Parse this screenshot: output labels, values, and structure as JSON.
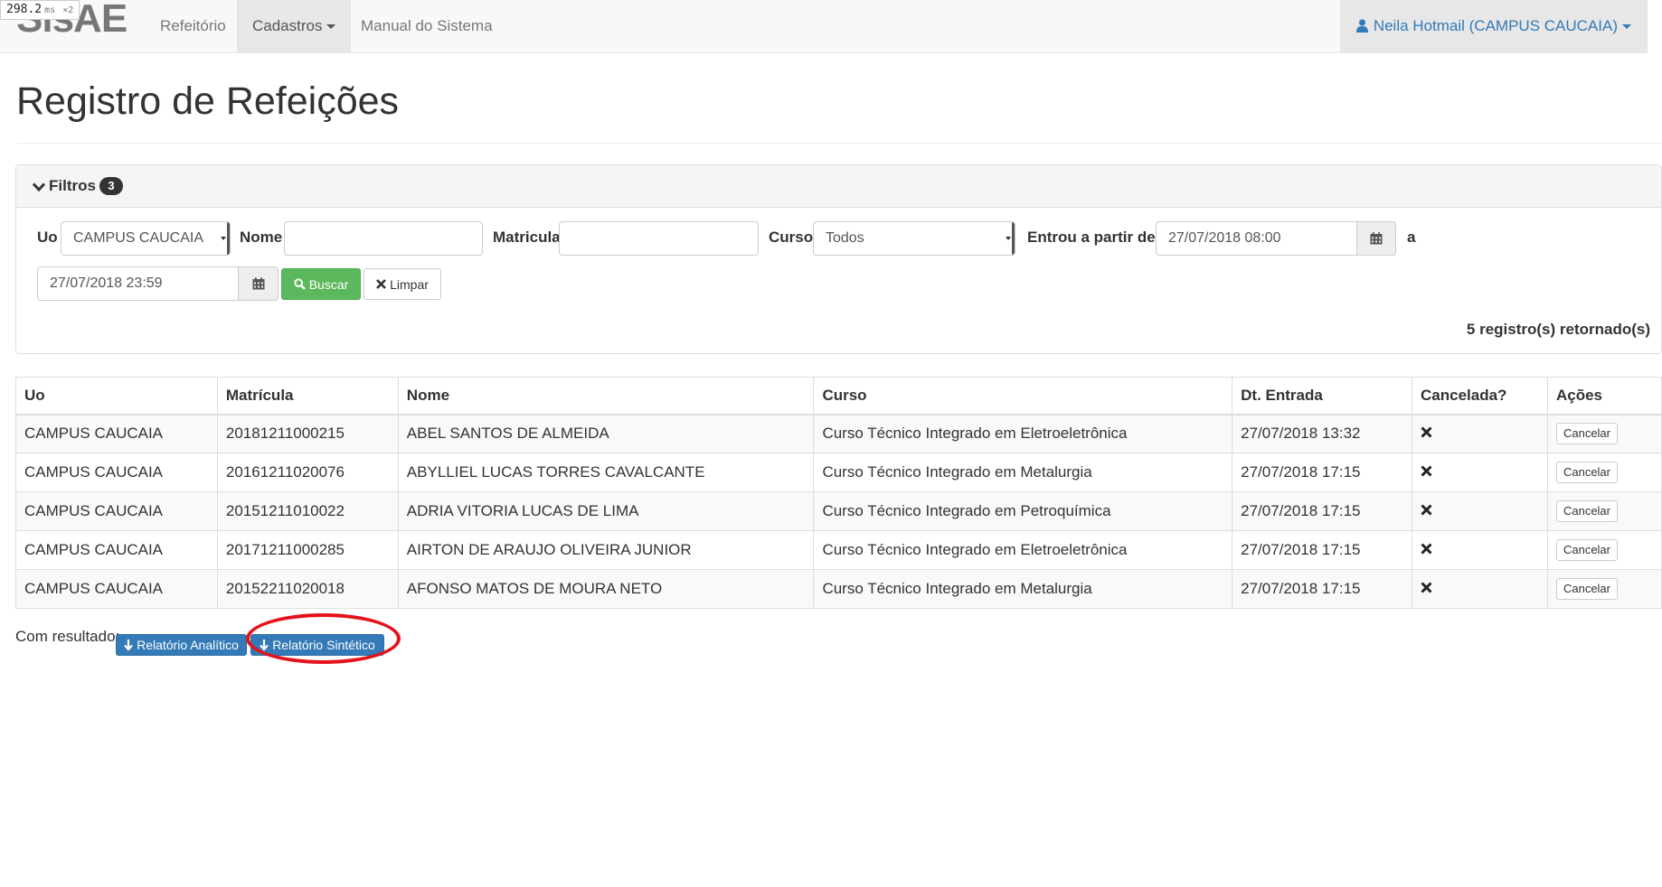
{
  "perf": {
    "value": "298.2",
    "unit": "ms",
    "mult": "×2"
  },
  "nav": {
    "brand": "SisAE",
    "items": [
      {
        "label": "Refeitório"
      },
      {
        "label": "Cadastros"
      },
      {
        "label": "Manual do Sistema"
      }
    ],
    "user": "Neila Hotmail (CAMPUS CAUCAIA)"
  },
  "page": {
    "title": "Registro de Refeições"
  },
  "filters": {
    "title": "Filtros",
    "count": "3",
    "uo_label": "Uo",
    "uo_value": "CAMPUS CAUCAIA",
    "nome_label": "Nome",
    "nome_value": "",
    "matricula_label": "Matricula",
    "matricula_value": "",
    "curso_label": "Curso",
    "curso_value": "Todos",
    "entrou_label": "Entrou a partir de",
    "date_from": "27/07/2018 08:00",
    "a_label": "a",
    "date_to": "27/07/2018 23:59",
    "buscar_label": "Buscar",
    "limpar_label": "Limpar",
    "result_count": "5 registro(s) retornado(s)"
  },
  "table": {
    "headers": [
      "Uo",
      "Matrícula",
      "Nome",
      "Curso",
      "Dt. Entrada",
      "Cancelada?",
      "Ações"
    ],
    "rows": [
      {
        "uo": "CAMPUS CAUCAIA",
        "matricula": "20181211000215",
        "nome": "ABEL SANTOS DE ALMEIDA",
        "curso": "Curso Técnico Integrado em Eletroeletrônica",
        "entrada": "27/07/2018 13:32",
        "action": "Cancelar"
      },
      {
        "uo": "CAMPUS CAUCAIA",
        "matricula": "20161211020076",
        "nome": "ABYLLIEL LUCAS TORRES CAVALCANTE",
        "curso": "Curso Técnico Integrado em Metalurgia",
        "entrada": "27/07/2018 17:15",
        "action": "Cancelar"
      },
      {
        "uo": "CAMPUS CAUCAIA",
        "matricula": "20151211010022",
        "nome": "ADRIA VITORIA LUCAS DE LIMA",
        "curso": "Curso Técnico Integrado em Petroquímica",
        "entrada": "27/07/2018 17:15",
        "action": "Cancelar"
      },
      {
        "uo": "CAMPUS CAUCAIA",
        "matricula": "20171211000285",
        "nome": "AIRTON DE ARAUJO OLIVEIRA JUNIOR",
        "curso": "Curso Técnico Integrado em Eletroeletrônica",
        "entrada": "27/07/2018 17:15",
        "action": "Cancelar"
      },
      {
        "uo": "CAMPUS CAUCAIA",
        "matricula": "20152211020018",
        "nome": "AFONSO MATOS DE MOURA NETO",
        "curso": "Curso Técnico Integrado em Metalurgia",
        "entrada": "27/07/2018 17:15",
        "action": "Cancelar"
      }
    ]
  },
  "footer": {
    "label": "Com resultado:",
    "analitico": "Relatório Analítico",
    "sintetico": "Relatório Sintético"
  },
  "colors": {
    "success": "#5cb85c",
    "primary": "#337ab7",
    "highlight": "#e3121b",
    "navbar": "#f8f8f8"
  },
  "icons": [
    "user-icon",
    "chevron-down-icon",
    "search-icon",
    "close-icon",
    "calendar-icon",
    "download-icon",
    "x-mark-icon"
  ]
}
